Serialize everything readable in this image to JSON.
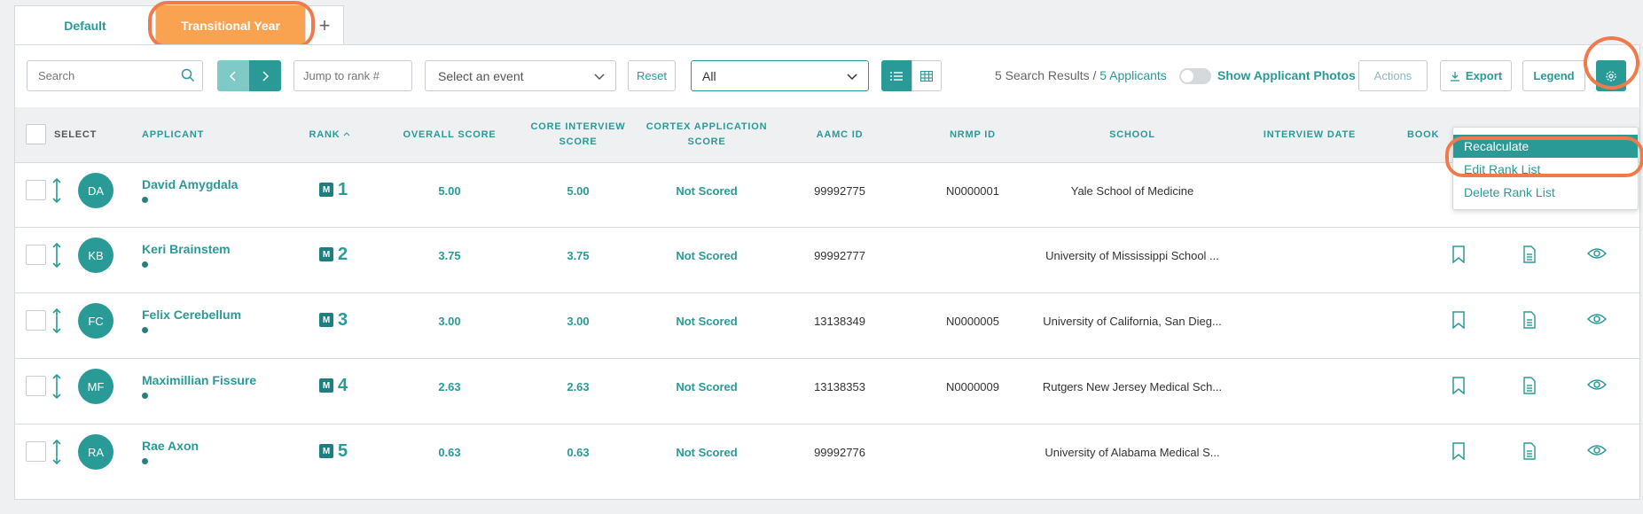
{
  "tabs": [
    {
      "label": "Default"
    },
    {
      "label": "Transitional Year"
    },
    {
      "label": "+"
    }
  ],
  "toolbar": {
    "search_placeholder": "Search",
    "jump_placeholder": "Jump to rank #",
    "event_placeholder": "Select an event",
    "reset_label": "Reset",
    "filter_value": "All",
    "results_count": "5 Search Results / ",
    "results_applicants": "5 Applicants",
    "photos_label": "Show Applicant Photos",
    "photos_toggle_on": false,
    "actions_label": "Actions",
    "export_label": "Export",
    "legend_label": "Legend"
  },
  "columns": {
    "select": "SELECT",
    "applicant": "APPLICANT",
    "rank": "RANK",
    "overall": "OVERALL SCORE",
    "core1": "CORE INTERVIEW",
    "core2": "SCORE",
    "cortex1": "CORTEX APPLICATION",
    "cortex2": "SCORE",
    "aamc": "AAMC ID",
    "nrmp": "NRMP ID",
    "school": "SCHOOL",
    "interview_date": "INTERVIEW DATE",
    "bookmark": "BOOK"
  },
  "rows": [
    {
      "initials": "DA",
      "name": "David Amygdala",
      "badge": "M",
      "rank": "1",
      "overall": "5.00",
      "core": "5.00",
      "cortex": "Not Scored",
      "aamc": "99992775",
      "nrmp": "N0000001",
      "school": "Yale School of Medicine"
    },
    {
      "initials": "KB",
      "name": "Keri Brainstem",
      "badge": "M",
      "rank": "2",
      "overall": "3.75",
      "core": "3.75",
      "cortex": "Not Scored",
      "aamc": "99992777",
      "nrmp": "",
      "school": "University of Mississippi School ..."
    },
    {
      "initials": "FC",
      "name": "Felix Cerebellum",
      "badge": "M",
      "rank": "3",
      "overall": "3.00",
      "core": "3.00",
      "cortex": "Not Scored",
      "aamc": "13138349",
      "nrmp": "N0000005",
      "school": "University of California, San Dieg..."
    },
    {
      "initials": "MF",
      "name": "Maximillian Fissure",
      "badge": "M",
      "rank": "4",
      "overall": "2.63",
      "core": "2.63",
      "cortex": "Not Scored",
      "aamc": "13138353",
      "nrmp": "N0000009",
      "school": "Rutgers New Jersey Medical Sch..."
    },
    {
      "initials": "RA",
      "name": "Rae Axon",
      "badge": "M",
      "rank": "5",
      "overall": "0.63",
      "core": "0.63",
      "cortex": "Not Scored",
      "aamc": "99992776",
      "nrmp": "",
      "school": "University of Alabama Medical S..."
    }
  ],
  "settings_menu": [
    {
      "label": "Recalculate"
    },
    {
      "label": "Edit Rank List"
    },
    {
      "label": "Delete Rank List"
    }
  ],
  "colors": {
    "accent": "#2a9a97",
    "active_tab": "#f9a351",
    "highlight_ring": "#f07a4a"
  }
}
